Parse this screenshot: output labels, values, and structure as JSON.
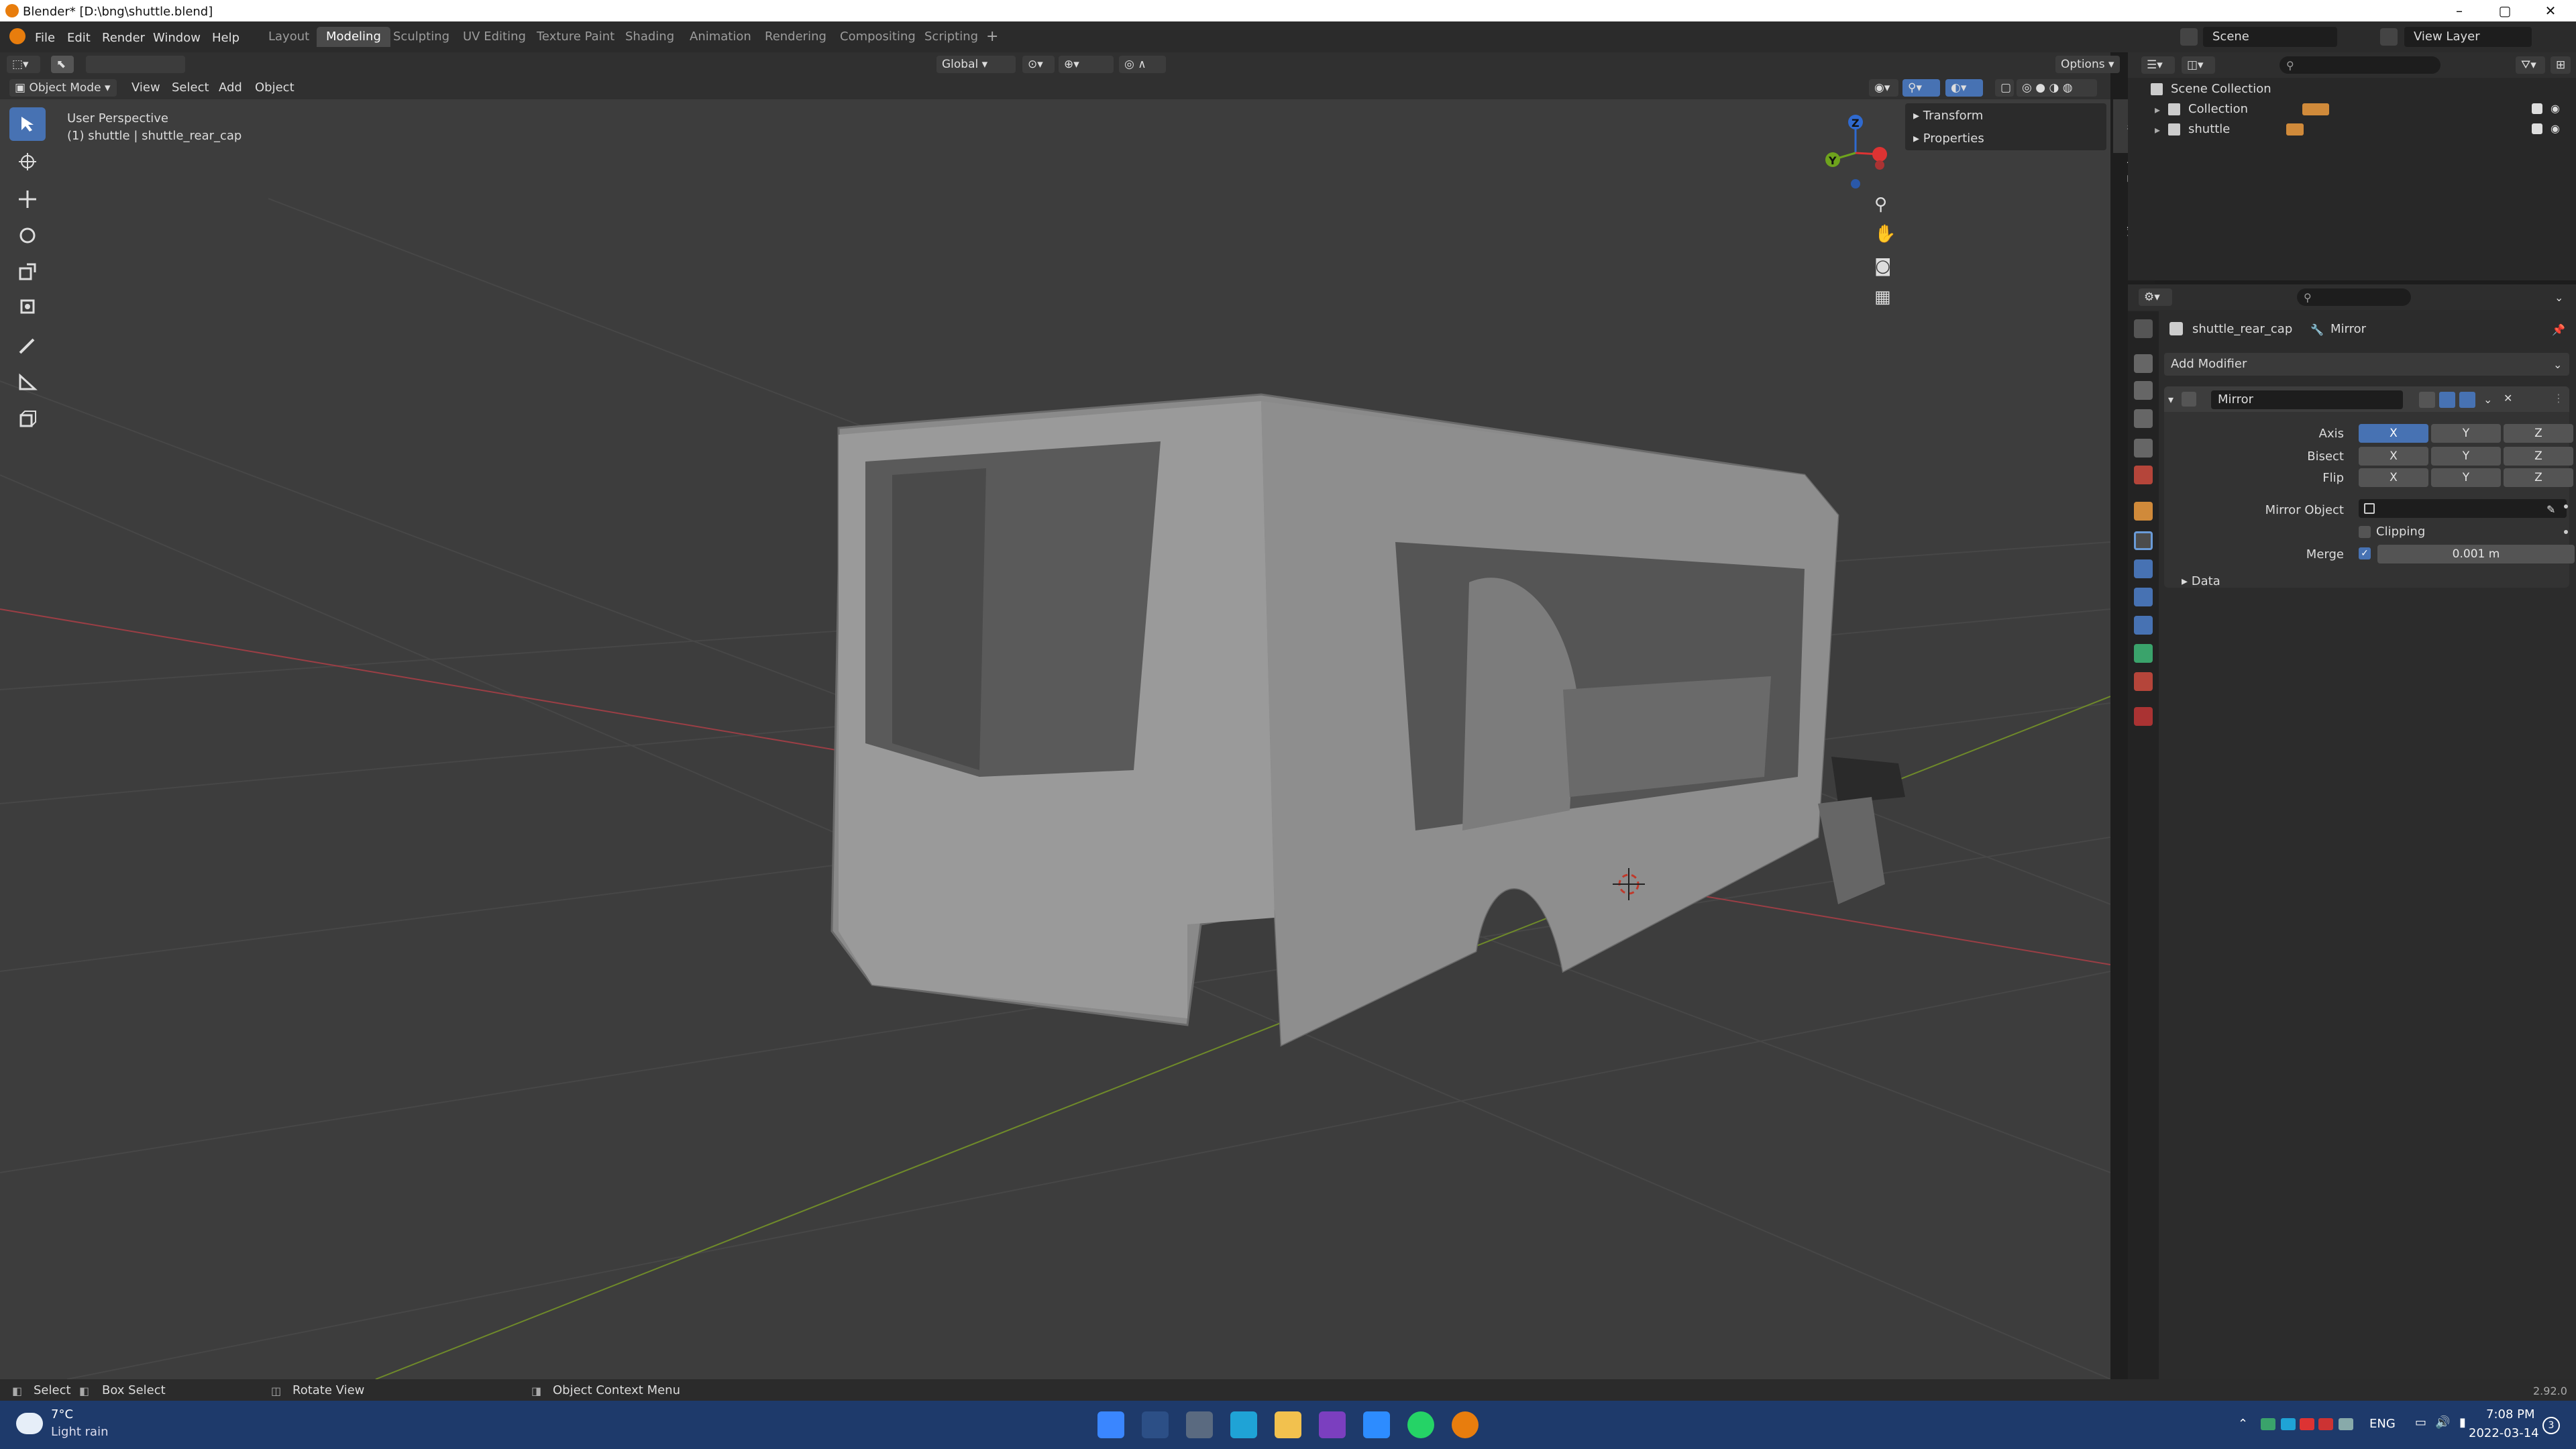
{
  "window": {
    "title": "Blender* [D:\\bng\\shuttle.blend]"
  },
  "menus": [
    "File",
    "Edit",
    "Render",
    "Window",
    "Help"
  ],
  "workspaces": [
    "Layout",
    "Modeling",
    "Sculpting",
    "UV Editing",
    "Texture Paint",
    "Shading",
    "Animation",
    "Rendering",
    "Compositing",
    "Scripting"
  ],
  "active_workspace": "Modeling",
  "scene": {
    "label": "Scene",
    "view_layer": "View Layer"
  },
  "viewport": {
    "mode": "Object Mode",
    "menus": [
      "View",
      "Select",
      "Add",
      "Object"
    ],
    "transform_orientation": "Global",
    "options_label": "Options",
    "perspective": "User Perspective",
    "object_info": "(1) shuttle | shuttle_rear_cap",
    "sidebar_panels": [
      "Transform",
      "Properties"
    ],
    "sidebar_tabs": [
      "Item",
      "Tool",
      "View"
    ],
    "gizmo_axes": {
      "x": "X",
      "y": "Y",
      "z": "Z"
    }
  },
  "outliner": {
    "root": "Scene Collection",
    "items": [
      {
        "name": "Collection"
      },
      {
        "name": "shuttle"
      }
    ]
  },
  "properties": {
    "object_name": "shuttle_rear_cap",
    "modifier_breadcrumb": "Mirror",
    "add_modifier": "Add Modifier",
    "modifier": {
      "name": "Mirror",
      "axis_label": "Axis",
      "bisect_label": "Bisect",
      "flip_label": "Flip",
      "axes": [
        "X",
        "Y",
        "Z"
      ],
      "axis_active": "X",
      "mirror_object_label": "Mirror Object",
      "clipping_label": "Clipping",
      "clipping": false,
      "merge_label": "Merge",
      "merge": true,
      "merge_value": "0.001 m",
      "data_label": "Data"
    }
  },
  "statusbar": {
    "select": "Select",
    "box_select": "Box Select",
    "rotate": "Rotate View",
    "context": "Object Context Menu",
    "version": "2.92.0"
  },
  "taskbar": {
    "temp": "7°C",
    "weather": "Light rain",
    "lang": "ENG",
    "time": "7:08 PM",
    "date": "2022-03-14",
    "notif": "3"
  },
  "colors": {
    "accent": "#4772b3",
    "viewport_bg": "#3d3d3d",
    "panel_bg": "#2c2c2c",
    "taskbar_bg": "#1e3a6b"
  }
}
